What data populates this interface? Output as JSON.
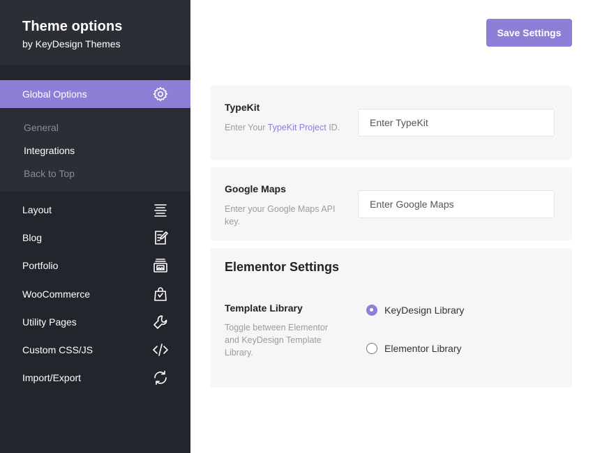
{
  "brand": {
    "title": "Theme options",
    "subtitle": "by KeyDesign Themes"
  },
  "sidebar": {
    "active": {
      "label": "Global Options",
      "icon": "gear-icon"
    },
    "submenu": [
      {
        "label": "General",
        "current": false
      },
      {
        "label": "Integrations",
        "current": true
      },
      {
        "label": "Back to Top",
        "current": false
      }
    ],
    "items": [
      {
        "label": "Layout",
        "icon": "align-lines-icon"
      },
      {
        "label": "Blog",
        "icon": "document-edit-icon"
      },
      {
        "label": "Portfolio",
        "icon": "portfolio-image-icon"
      },
      {
        "label": "WooCommerce",
        "icon": "shopping-bag-icon"
      },
      {
        "label": "Utility Pages",
        "icon": "wrench-icon"
      },
      {
        "label": "Custom CSS/JS",
        "icon": "code-icon"
      },
      {
        "label": "Import/Export",
        "icon": "sync-icon"
      }
    ]
  },
  "toolbar": {
    "save_label": "Save Settings"
  },
  "typekit": {
    "label": "TypeKit",
    "desc_prefix": "Enter Your ",
    "desc_link": "TypeKit Project",
    "desc_suffix": " ID.",
    "placeholder": "Enter TypeKit"
  },
  "google_maps": {
    "label": "Google Maps",
    "desc": "Enter your Google Maps API key.",
    "placeholder": "Enter Google Maps"
  },
  "elementor": {
    "title": "Elementor Settings",
    "template_label": "Template Library",
    "template_desc": "Toggle between Elementor and KeyDesign Template Library.",
    "options": [
      {
        "label": "KeyDesign Library",
        "checked": true
      },
      {
        "label": "Elementor Library",
        "checked": false
      }
    ]
  },
  "colors": {
    "accent": "#8e7fd6",
    "sidebar_bg": "#22252b",
    "card_bg": "#f6f6f7"
  }
}
